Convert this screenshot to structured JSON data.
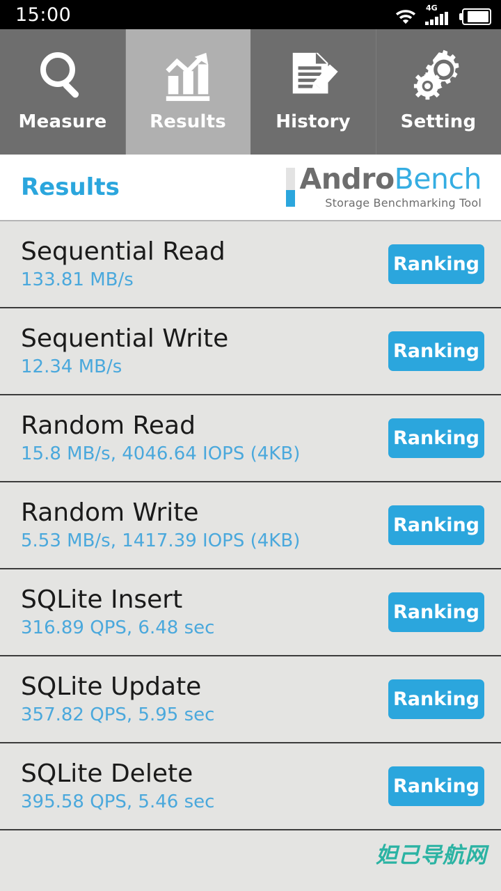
{
  "statusbar": {
    "time": "15:00",
    "wifi_icon": "wifi-icon",
    "network_label": "4G",
    "signal_icon": "signal-bars-icon",
    "battery_icon": "battery-icon"
  },
  "tabs": [
    {
      "label": "Measure",
      "icon": "magnifier-icon",
      "active": false
    },
    {
      "label": "Results",
      "icon": "bar-chart-arrow-icon",
      "active": true
    },
    {
      "label": "History",
      "icon": "document-pencil-icon",
      "active": false
    },
    {
      "label": "Setting",
      "icon": "gears-icon",
      "active": false
    }
  ],
  "header": {
    "title": "Results",
    "logo_primary": "Andro",
    "logo_secondary": "Bench",
    "logo_tagline": "Storage Benchmarking Tool"
  },
  "results": [
    {
      "title": "Sequential Read",
      "value": "133.81 MB/s",
      "button": "Ranking"
    },
    {
      "title": "Sequential Write",
      "value": "12.34 MB/s",
      "button": "Ranking"
    },
    {
      "title": "Random Read",
      "value": "15.8 MB/s, 4046.64 IOPS (4KB)",
      "button": "Ranking"
    },
    {
      "title": "Random Write",
      "value": "5.53 MB/s, 1417.39 IOPS (4KB)",
      "button": "Ranking"
    },
    {
      "title": "SQLite Insert",
      "value": "316.89 QPS, 6.48 sec",
      "button": "Ranking"
    },
    {
      "title": "SQLite Update",
      "value": "357.82 QPS, 5.95 sec",
      "button": "Ranking"
    },
    {
      "title": "SQLite Delete",
      "value": "395.58 QPS, 5.46 sec",
      "button": "Ranking"
    }
  ],
  "watermark": "妲己导航网",
  "colors": {
    "accent_blue": "#2ba6dd",
    "value_blue": "#4aa8dc",
    "tab_inactive": "#6e6e6e",
    "tab_active": "#b0b0b0",
    "list_background": "#e4e4e2",
    "watermark_teal": "#2bb3a3"
  }
}
